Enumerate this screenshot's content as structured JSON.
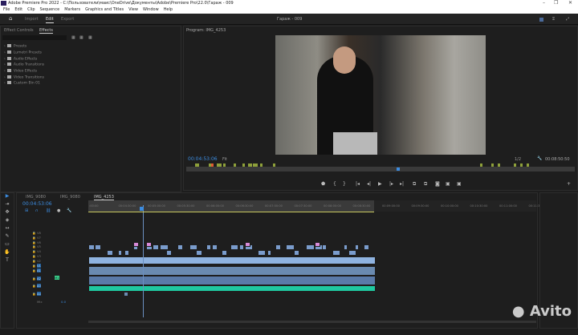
{
  "window": {
    "title": "Adobe Premiere Pro 2022 - C:\\Пользователи\\маис\\OneDrive\\Документы\\Adobe\\Premiere Pro\\22.0\\Гараж - 009",
    "minimize": "–",
    "maximize": "❐",
    "close": "✕"
  },
  "menu": [
    "File",
    "Edit",
    "Clip",
    "Sequence",
    "Markers",
    "Graphics and Titles",
    "View",
    "Window",
    "Help"
  ],
  "header": {
    "tabs": [
      "Import",
      "Edit",
      "Export"
    ],
    "active": "Edit",
    "project_title": "Гараж - 009"
  },
  "left_panel": {
    "tabs": [
      "Effect Controls",
      "Effects"
    ],
    "active": "Effects",
    "items": [
      "Presets",
      "Lumetri Presets",
      "Audio Effects",
      "Audio Transitions",
      "Video Effects",
      "Video Transitions",
      "Custom Bin 01"
    ]
  },
  "program": {
    "title": "Program: IMG_4253",
    "timecode": "00:04:53:06",
    "zoom": "Fit",
    "resolution": "1/2",
    "duration": "00:08:50:50"
  },
  "timeline": {
    "sequence_tabs": [
      "IMG_9080",
      "IMG_9080",
      "IMG_4253"
    ],
    "active": "IMG_4253",
    "timecode": "00:04:53:06",
    "ruler": [
      ":00:00",
      "00:04:30:00",
      "00:05:00:00",
      "00:05:30:00",
      "00:06:00:00",
      "00:06:30:00",
      "00:07:00:00",
      "00:07:30:00",
      "00:08:00:00",
      "00:08:30:00",
      "00:09:00:00",
      "00:09:30:00",
      "00:10:00:00",
      "00:10:30:00",
      "00:11:00:00",
      "00:11:30"
    ],
    "video_tracks": [
      "V8",
      "V7",
      "V6",
      "V5",
      "V4",
      "V3",
      "V2",
      "V1"
    ],
    "audio_tracks": [
      "A1",
      "A2",
      "A3",
      "A4"
    ],
    "mix": "Mix",
    "mix_value": "0.0",
    "a2_label": "M1"
  },
  "watermark": "Avito",
  "colors": {
    "timecode": "#3c8ce0",
    "video_clip": "#8fb3e0",
    "audio_clip": "#1fc8a0",
    "marker": "#8ea03a",
    "pink": "#d88ad8"
  }
}
